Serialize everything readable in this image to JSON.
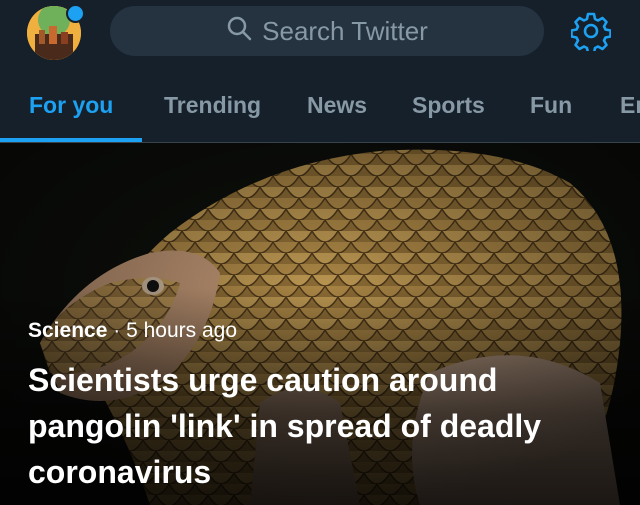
{
  "search": {
    "placeholder": "Search Twitter"
  },
  "tabs": [
    {
      "label": "For you",
      "active": true
    },
    {
      "label": "Trending",
      "active": false
    },
    {
      "label": "News",
      "active": false
    },
    {
      "label": "Sports",
      "active": false
    },
    {
      "label": "Fun",
      "active": false
    },
    {
      "label": "Er",
      "active": false
    }
  ],
  "story": {
    "category": "Science",
    "separator": "·",
    "time": "5 hours ago",
    "headline": "Scientists urge caution around pangolin 'link' in spread of deadly coronavirus"
  },
  "colors": {
    "accent": "#1da1f2",
    "background": "#15202b"
  },
  "icons": {
    "search": "search-icon",
    "settings": "gear-icon"
  }
}
